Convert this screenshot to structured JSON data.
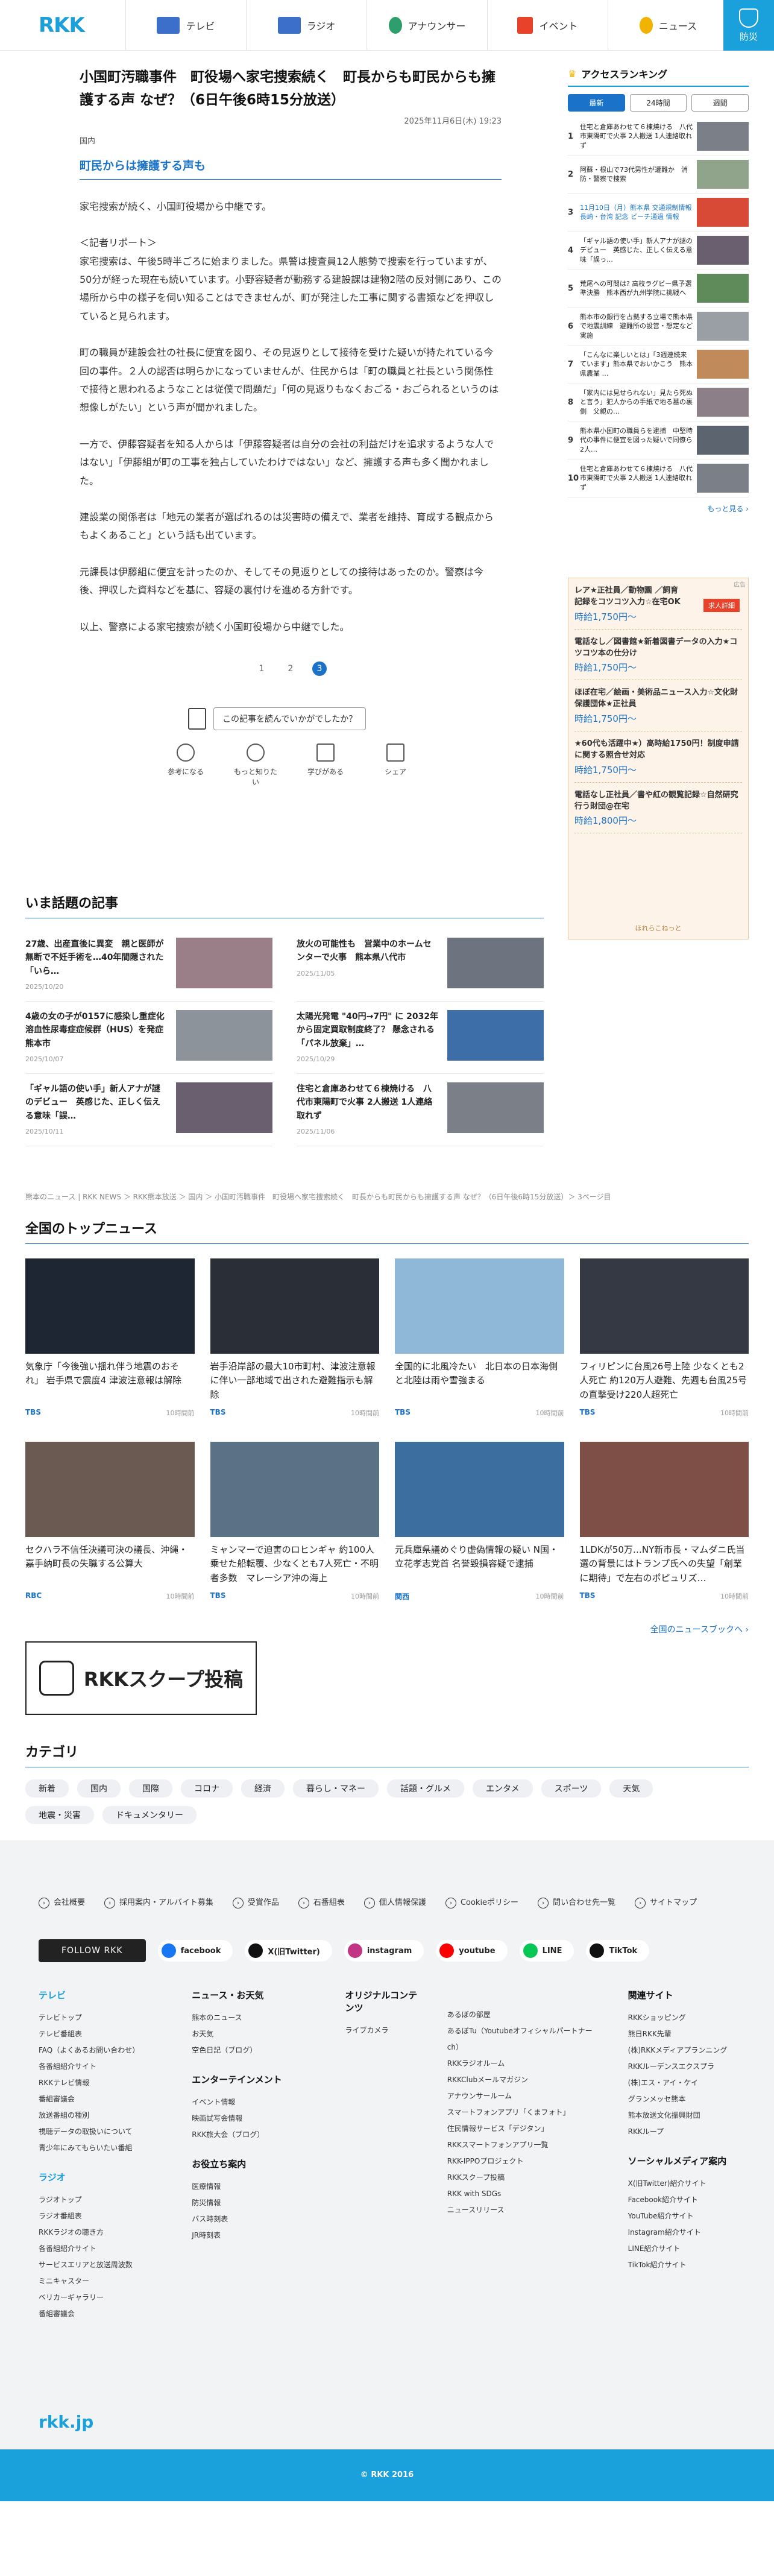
{
  "header": {
    "logo": "RKK",
    "nav": [
      {
        "label": "テレビ",
        "icon": "tv-icon",
        "color": "#3b6fc9"
      },
      {
        "label": "ラジオ",
        "icon": "radio-icon",
        "color": "#3b6fc9"
      },
      {
        "label": "アナウンサー",
        "icon": "announcer-icon",
        "color": "#2e9e6c"
      },
      {
        "label": "イベント",
        "icon": "event-icon",
        "color": "#e8422b"
      },
      {
        "label": "ニュース",
        "icon": "news-icon",
        "color": "#f0b400"
      }
    ],
    "bousai": "防災"
  },
  "article": {
    "title": "小国町汚職事件　町役場へ家宅捜索続く　町長からも町民からも擁護する声 なぜ？（6日午後6時15分放送）",
    "date": "2025年11月6日(木) 19:23",
    "category": "国内",
    "subheading": "町民からは擁護する声も",
    "paragraphs": [
      "家宅捜索が続く、小国町役場から中継です。",
      "＜記者リポート＞\n家宅捜索は、午後5時半ごろに始まりました。県警は捜査員12人態勢で捜索を行っていますが、50分が経った現在も続いています。小野容疑者が勤務する建設課は建物2階の反対側にあり、この場所から中の様子を伺い知ることはできませんが、町が発注した工事に関する書類などを押収していると見られます。",
      "町の職員が建設会社の社長に便宜を図り、その見返りとして接待を受けた疑いが持たれている今回の事件。２人の認否は明らかになっていませんが、住民からは「町の職員と社長という関係性で接待と思われるようなことは従僕で問題だ」「何の見返りもなくおごる・おごられるというのは想像しがたい」という声が聞かれました。",
      "一方で、伊藤容疑者を知る人からは「伊藤容疑者は自分の会社の利益だけを追求するような人ではない」「伊藤組が町の工事を独占していたわけではない」など、擁護する声も多く聞かれました。",
      "建設業の関係者は「地元の業者が選ばれるのは災害時の備えで、業者を維持、育成する観点からもよくあること」という話も出ています。",
      "元課長は伊藤組に便宜を計ったのか、そしてその見返りとしての接待はあったのか。警察は今後、押収した資料などを基に、容疑の裏付けを進める方針です。",
      "以上、警察による家宅捜索が続く小国町役場から中継でした。"
    ],
    "pages": [
      "1",
      "2",
      "3"
    ],
    "current_page": "3",
    "feedback_label": "この記事を読んでいかがでしたか？",
    "reactions": [
      {
        "label": "参考になる",
        "icon": "lightbulb-icon"
      },
      {
        "label": "もっと知りたい",
        "icon": "magnifier-icon"
      },
      {
        "label": "学びがある",
        "icon": "book-icon"
      },
      {
        "label": "シェア",
        "icon": "share-icon"
      }
    ]
  },
  "popular": {
    "title": "いま話題の記事",
    "items": [
      {
        "title": "27歳、出産直後に異変　親と医師が無断で不妊手術を…40年間隠された「いら…",
        "date": "2025/10/20"
      },
      {
        "title": "放火の可能性も　営業中のホームセンターで火事　熊本県八代市",
        "date": "2025/11/05"
      },
      {
        "title": "4歳の女の子が0157に感染し重症化　溶血性尿毒症症候群（HUS）を発症　熊本市",
        "date": "2025/10/07"
      },
      {
        "title": "太陽光発電 \"40円→7円\" に 2032年から固定買取制度終了？ 懸念される「パネル放棄」…",
        "date": "2025/10/29"
      },
      {
        "title": "「ギャル語の使い手」新人アナが謎のデビュー　英感じた、正しく伝える意味「誤…",
        "date": "2025/10/11"
      },
      {
        "title": "住宅と倉庫あわせて６棟焼ける　八代市東陽町で火事 2人搬送 1人連絡取れず",
        "date": "2025/11/06"
      }
    ]
  },
  "breadcrumb": "熊本のニュース | RKK NEWS ＞ RKK熊本放送 ＞ 国内 ＞ 小国町汚職事件　町役場へ家宅捜索続く　町長からも町民からも擁護する声 なぜ？（6日午後6時15分放送）＞ 3ページ目",
  "national": {
    "title": "全国のトップニュース",
    "items": [
      {
        "caption": "気象庁「今後強い揺れ伴う地震のおそれ」 岩手県で震度4 津波注意報は解除",
        "source": "TBS",
        "ago": "10時間前"
      },
      {
        "caption": "岩手沿岸部の最大10市町村、津波注意報に伴い一部地域で出された避難指示も解除",
        "source": "TBS",
        "ago": "10時間前"
      },
      {
        "caption": "全国的に北風冷たい　北日本の日本海側と北陸は雨や雪強まる",
        "source": "TBS",
        "ago": "10時間前"
      },
      {
        "caption": "フィリピンに台風26号上陸 少なくとも2人死亡 約120万人避難、先週も台風25号の直撃受け220人超死亡",
        "source": "TBS",
        "ago": "10時間前"
      },
      {
        "caption": "セクハラ不信任決議可決の議長、沖縄・嘉手納町長の失職する公算大",
        "source": "RBC",
        "ago": "10時間前"
      },
      {
        "caption": "ミャンマーで迫害のロヒンギャ 約100人乗せた船転覆、少なくとも7人死亡・不明者多数　マレーシア沖の海上",
        "source": "TBS",
        "ago": "10時間前"
      },
      {
        "caption": "元兵庫県議めぐり虚偽情報の疑い N国・立花孝志党首 名誉毀損容疑で逮捕",
        "source": "関西",
        "ago": "10時間前"
      },
      {
        "caption": "1LDKが50万…NY新市長・マムダニ氏当選の背景にはトランプ氏への失望「創業に期待」で左右のポピュリズ…",
        "source": "TBS",
        "ago": "10時間前"
      }
    ],
    "more": "全国のニュースブックへ ›"
  },
  "scoop": {
    "label": "RKKスクープ投稿"
  },
  "category": {
    "title": "カテゴリ",
    "tags": [
      "新着",
      "国内",
      "国際",
      "コロナ",
      "経済",
      "暮らし・マネー",
      "話題・グルメ",
      "エンタメ",
      "スポーツ",
      "天気",
      "地震・災害",
      "ドキュメンタリー"
    ]
  },
  "sidebar": {
    "ranking_title": "アクセスランキング",
    "tabs": [
      "最新",
      "24時間",
      "週間"
    ],
    "active_tab": "最新",
    "items": [
      {
        "num": "1",
        "title": "住宅と倉庫あわせて６棟焼ける　八代市東陽町で火事 2人搬送 1人連絡取れず"
      },
      {
        "num": "2",
        "title": "阿蘇・根山で73代男性が遭難か　消防・警察で捜索"
      },
      {
        "num": "3",
        "title": "11月10日（月）熊本県 交通規制情報 長崎・台湾 記念 ビーチ通過 情報"
      },
      {
        "num": "4",
        "title": "「ギャル語の使い手」新人アナが謎のデビュー　英感じた、正しく伝える意味「誤っ…"
      },
      {
        "num": "5",
        "title": "荒尾への可問は? 高校ラグビー県予選準決勝　熊本西が九州学院に挑戦へ"
      },
      {
        "num": "6",
        "title": "熊本市の銀行を占拠する立場で熊本県で地震訓練　避難所の設営・想定など実施"
      },
      {
        "num": "7",
        "title": "「こんなに楽しいとは」「3週連続来ています」熊本県でおいかこう　熊本県農業 …"
      },
      {
        "num": "8",
        "title": "「家内には見せられない」見たら死ぬと言う」犯人からの手紙で地る墓の裏側　父親の…"
      },
      {
        "num": "9",
        "title": "熊本県小国町の職員らを逮捕　中堅時代の事件に便宜を図った疑いで同僚ら　2人…"
      },
      {
        "num": "10",
        "title": "住宅と倉庫あわせて６棟焼ける　八代市東陽町で火事 2人搬送 1人連絡取れず"
      }
    ],
    "more": "もっと見る ›"
  },
  "ad": {
    "badge": "広告",
    "tag": "求人詳細",
    "items": [
      {
        "text": "レア★正社員／動物園 ／飼育記録をコツコツ入力☆在宅OK",
        "price": "時給1,750円～"
      },
      {
        "text": "電話なし／図書館★新着図書データの入力★コツコツ本の仕分け",
        "price": "時給1,750円～"
      },
      {
        "text": "ほぼ在宅／絵画・美術品ニュース入力☆文化財保護団体★正社員",
        "price": "時給1,750円～"
      },
      {
        "text": "★60代も活躍中★）高時給1750円！制度申請に関する照合せ対応",
        "price": "時給1,750円～"
      },
      {
        "text": "電話なし正社員／書や紅の観覧記録☆自然研究行う財団@在宅",
        "price": "時給1,800円～"
      }
    ],
    "footer": "ほれらこねっと"
  },
  "footer": {
    "links": [
      "会社概要",
      "採用案内・アルバイト募集",
      "受賞作品",
      "石番組表",
      "個人情報保護",
      "Cookieポリシー",
      "問い合わせ先一覧",
      "サイトマップ"
    ],
    "follow": "FOLLOW RKK",
    "sns": [
      {
        "label": "facebook",
        "color": "#1877f2"
      },
      {
        "label": "X(旧Twitter)",
        "color": "#111111"
      },
      {
        "label": "instagram",
        "color": "#c13584"
      },
      {
        "label": "youtube",
        "color": "#ff0000"
      },
      {
        "label": "LINE",
        "color": "#06c755"
      },
      {
        "label": "TikTok",
        "color": "#111111"
      }
    ],
    "columns": [
      {
        "groups": [
          {
            "title": "テレビ",
            "items": [
              "テレビトップ",
              "テレビ番組表",
              "FAQ（よくあるお問い合わせ）",
              "各番組紹介サイト",
              "RKKテレビ情報",
              "番組審議会",
              "放送番組の種別",
              "視聴データの取扱いについて",
              "青少年にみてもらいたい番組"
            ]
          },
          {
            "title": "ラジオ",
            "items": [
              "ラジオトップ",
              "ラジオ番組表",
              "RKKラジオの聴き方",
              "各番組紹介サイト",
              "サービスエリアと放送周波数",
              "ミニキャスター",
              "ベリカーギャラリー",
              "番組審議会"
            ]
          }
        ]
      },
      {
        "groups": [
          {
            "title": "ニュース・お天気",
            "items": [
              "熊本のニュース",
              "お天気",
              "空色日記（ブログ）"
            ]
          },
          {
            "title": "エンターテインメント",
            "items": [
              "イベント情報",
              "映画試写会情報",
              "RKK旅大会（ブログ）"
            ]
          },
          {
            "title": "お役立ち案内",
            "items": [
              "医療情報",
              "防災情報",
              "バス時刻表",
              "JR時刻表"
            ]
          }
        ]
      },
      {
        "groups": [
          {
            "title": "オリジナルコンテンツ",
            "items": [
              "ライブカメラ"
            ]
          }
        ]
      },
      {
        "groups": [
          {
            "title": "",
            "items": [
              "あるぼの部屋",
              "あるぼTu（Youtubeオフィシャルパートナーch）",
              "RKKラジオルーム",
              "RKKClubメールマガジン",
              "アナウンサールーム",
              "スマートフォンアプリ「くまフォト」",
              "住民情報サービス「デジタン」",
              "RKKスマートフォンアプリ一覧",
              "RKK-IPPOプロジェクト",
              "RKKスクープ投稿",
              "RKK with SDGs",
              "ニュースリリース"
            ]
          }
        ]
      },
      {
        "groups": [
          {
            "title": "関連サイト",
            "items": [
              "RKKショッピング",
              "熊日RKK先輩",
              "(株)RKKメディアプランニング",
              "RKKルーデンスエクスプラ",
              "(株)エス・アイ・ケイ",
              "グランメッセ熊本",
              "熊本放送文化振興財団",
              "RKKループ"
            ]
          },
          {
            "title": "ソーシャルメディア案内",
            "items": [
              "X(旧Twitter)紹介サイト",
              "Facebook紹介サイト",
              "YouTube紹介サイト",
              "Instagram紹介サイト",
              "LINE紹介サイト",
              "TikTok紹介サイト"
            ]
          }
        ]
      }
    ],
    "site": "rkk.jp",
    "copyright": "© RKK 2016"
  },
  "colors": {
    "brand": "#1aa0db",
    "link": "#1a73c9"
  }
}
